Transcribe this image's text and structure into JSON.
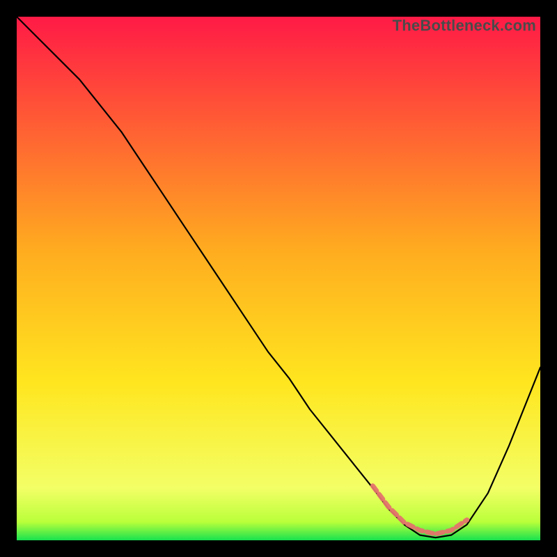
{
  "watermark": "TheBottleneck.com",
  "colors": {
    "bg_black": "#000000",
    "grad_top": "#ff1a46",
    "grad_mid": "#ffd21f",
    "grad_low": "#f3ff66",
    "grad_bottom": "#17e24e",
    "curve": "#000000",
    "bump": "#e4736b"
  },
  "chart_data": {
    "type": "line",
    "title": "",
    "xlabel": "",
    "ylabel": "",
    "xlim": [
      0,
      100
    ],
    "ylim": [
      0,
      100
    ],
    "series": [
      {
        "name": "bottleneck-curve",
        "x": [
          0,
          4,
          8,
          12,
          16,
          20,
          24,
          28,
          32,
          36,
          40,
          44,
          48,
          52,
          56,
          60,
          64,
          68,
          71,
          74,
          77,
          80,
          83,
          86,
          90,
          94,
          98,
          100
        ],
        "values": [
          100,
          96,
          92,
          88,
          83,
          78,
          72,
          66,
          60,
          54,
          48,
          42,
          36,
          31,
          25,
          20,
          15,
          10,
          6,
          3,
          1,
          0.5,
          1,
          3,
          9,
          18,
          28,
          33
        ]
      }
    ],
    "bump_segment": {
      "comment": "slightly raised salmon overlay near the valley",
      "x": [
        68,
        71,
        74,
        77,
        80,
        83,
        86
      ],
      "values": [
        10,
        6,
        3,
        1.5,
        0.8,
        1.5,
        3.5
      ]
    },
    "gradient_stops": [
      {
        "offset": 0.0,
        "color": "#ff1a46"
      },
      {
        "offset": 0.45,
        "color": "#ffad1f"
      },
      {
        "offset": 0.7,
        "color": "#ffe61f"
      },
      {
        "offset": 0.9,
        "color": "#f3ff66"
      },
      {
        "offset": 0.965,
        "color": "#baff3a"
      },
      {
        "offset": 1.0,
        "color": "#17e24e"
      }
    ]
  }
}
